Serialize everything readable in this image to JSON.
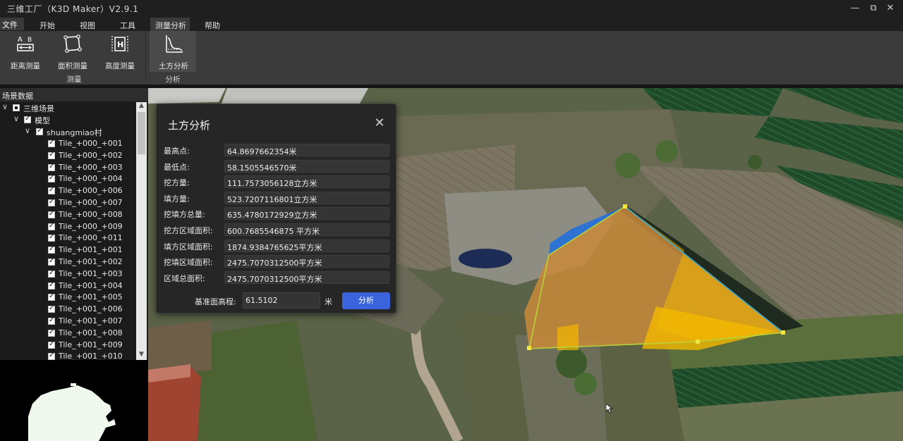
{
  "window": {
    "title": "三维工厂（K3D Maker）V2.9.1",
    "minimize": "—",
    "restore": "⧉",
    "close": "✕"
  },
  "menu": {
    "file": "文件",
    "items": [
      "开始",
      "视图",
      "工具",
      "测量分析",
      "帮助"
    ],
    "active": "测量分析"
  },
  "ribbon": {
    "buttons": [
      {
        "label": "距离测量",
        "icon": "distance-measure-icon"
      },
      {
        "label": "面积测量",
        "icon": "area-measure-icon"
      },
      {
        "label": "高度测量",
        "icon": "height-measure-icon"
      },
      {
        "label": "土方分析",
        "icon": "earthwork-analysis-icon"
      }
    ],
    "groups": [
      "测量",
      "分析"
    ]
  },
  "scene_panel": {
    "title": "场景数据",
    "root": "三维场景",
    "model": "模型",
    "village": "shuangmiao村",
    "tiles": [
      "Tile_+000_+001",
      "Tile_+000_+002",
      "Tile_+000_+003",
      "Tile_+000_+004",
      "Tile_+000_+006",
      "Tile_+000_+007",
      "Tile_+000_+008",
      "Tile_+000_+009",
      "Tile_+000_+011",
      "Tile_+001_+001",
      "Tile_+001_+002",
      "Tile_+001_+003",
      "Tile_+001_+004",
      "Tile_+001_+005",
      "Tile_+001_+006",
      "Tile_+001_+007",
      "Tile_+001_+008",
      "Tile_+001_+009",
      "Tile_+001_+010"
    ]
  },
  "dialog": {
    "title": "土方分析",
    "close": "✕",
    "rows": [
      {
        "label": "最高点:",
        "value": "64.8697662354米"
      },
      {
        "label": "最低点:",
        "value": "58.1505546570米"
      },
      {
        "label": "挖方量:",
        "value": "111.7573056128立方米"
      },
      {
        "label": "填方量:",
        "value": "523.7207116801立方米"
      },
      {
        "label": "挖填方总量:",
        "value": "635.4780172929立方米"
      },
      {
        "label": "挖方区域面积:",
        "value": "600.7685546875 平方米"
      },
      {
        "label": "填方区域面积:",
        "value": "1874.9384765625平方米"
      },
      {
        "label": "挖填区域面积:",
        "value": "2475.7070312500平方米"
      },
      {
        "label": "区域总面积:",
        "value": "2475.7070312500平方米"
      }
    ],
    "base_label": "基准面高程:",
    "base_value": "61.5102",
    "base_unit": "米",
    "analyze_button": "分析"
  },
  "colors": {
    "accent": "#3a63dc",
    "fill_region": "#c98a3a",
    "fill_yellow": "#f2b800",
    "cut_blue": "#1e6fe0"
  }
}
